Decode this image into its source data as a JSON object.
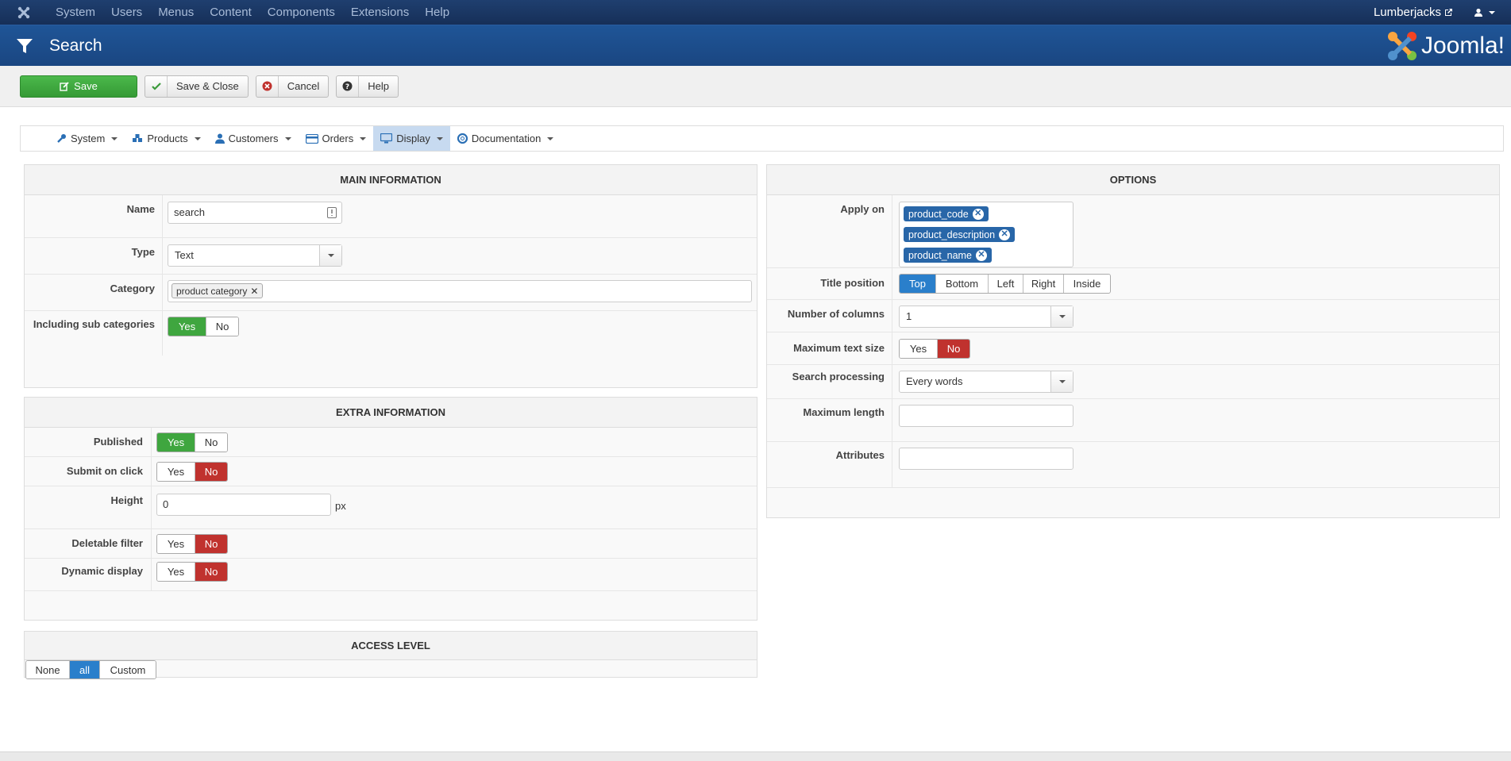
{
  "topnav": {
    "menu": [
      "System",
      "Users",
      "Menus",
      "Content",
      "Components",
      "Extensions",
      "Help"
    ],
    "site_name": "Lumberjacks"
  },
  "header": {
    "title": "Search",
    "brand": "Joomla!"
  },
  "toolbar": {
    "save": "Save",
    "save_close": "Save & Close",
    "cancel": "Cancel",
    "help": "Help"
  },
  "subnav": {
    "items": [
      "System",
      "Products",
      "Customers",
      "Orders",
      "Display",
      "Documentation"
    ],
    "active": "Display"
  },
  "main_info": {
    "title": "MAIN INFORMATION",
    "name_label": "Name",
    "name_value": "search",
    "type_label": "Type",
    "type_value": "Text",
    "category_label": "Category",
    "category_chip": "product category",
    "sub_label": "Including sub categories",
    "yes": "Yes",
    "no": "No"
  },
  "extra_info": {
    "title": "EXTRA INFORMATION",
    "published": "Published",
    "submit_on_click": "Submit on click",
    "height": "Height",
    "height_value": "0",
    "height_unit": "px",
    "deletable": "Deletable filter",
    "dynamic": "Dynamic display",
    "yes": "Yes",
    "no": "No"
  },
  "access": {
    "title": "ACCESS LEVEL",
    "none": "None",
    "all": "all",
    "custom": "Custom"
  },
  "options": {
    "title": "OPTIONS",
    "apply_on": "Apply on",
    "tags": [
      "product_code",
      "product_description",
      "product_name"
    ],
    "title_position": "Title position",
    "positions": [
      "Top",
      "Bottom",
      "Left",
      "Right",
      "Inside"
    ],
    "num_columns": "Number of columns",
    "num_columns_value": "1",
    "max_text_size": "Maximum text size",
    "yes": "Yes",
    "no": "No",
    "search_processing": "Search processing",
    "search_processing_value": "Every words",
    "max_length": "Maximum length",
    "attributes": "Attributes"
  }
}
